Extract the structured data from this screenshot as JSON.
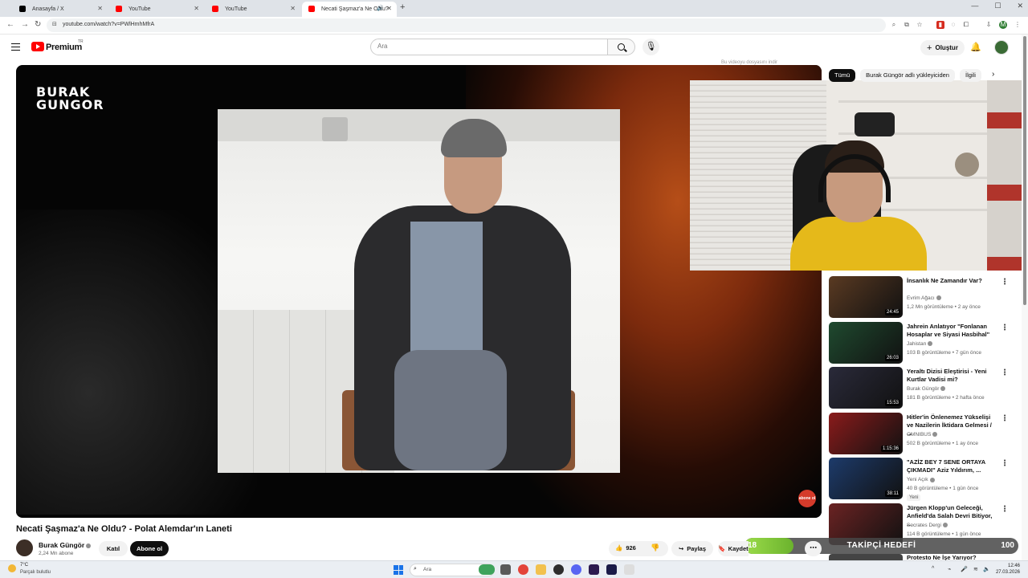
{
  "browser": {
    "tabs": [
      {
        "title": "Anasayfa / X",
        "favicon_color": "#000000"
      },
      {
        "title": "YouTube",
        "favicon_color": "#ff0000"
      },
      {
        "title": "YouTube",
        "favicon_color": "#ff0000"
      },
      {
        "title": "Necati Şaşmaz'a Ne Oldu?",
        "favicon_color": "#ff0000",
        "active": true
      }
    ],
    "url": "youtube.com/watch?v=PWlHmhMfrA"
  },
  "header": {
    "brand": "Premium",
    "region": "TR",
    "search_placeholder": "Ara",
    "create_label": "Oluştur"
  },
  "player": {
    "watermark_line1": "BURAK",
    "watermark_line2": "GUNGOR",
    "corner_badge": "abone ol",
    "overlay_tag": "Bu videoyu dosyasını indir"
  },
  "chips": [
    "Tümü",
    "Burak Güngör adlı yükleyiciden",
    "İlgili"
  ],
  "recommendations": [
    {
      "title": "İnsanlık Ne Zamandır Var?",
      "channel": "Evrim Ağacı",
      "meta": "1,2 Mn görüntüleme • 2 ay önce",
      "duration": "24:45",
      "thumb": "#5a3a22"
    },
    {
      "title": "Jahrein Anlatıyor \"Fonlanan Hosaplar ve Siyasi Hasbihal\"",
      "channel": "Jahistan",
      "meta": "103 B görüntüleme • 7 gün önce",
      "duration": "26:03",
      "thumb": "#1f4a2f"
    },
    {
      "title": "Yeraltı Dizisi Eleştirisi - Yeni Kurtlar Vadisi mi?",
      "channel": "Burak Güngör",
      "meta": "181 B görüntüleme • 2 hafta önce",
      "duration": "15:53",
      "thumb": "#2a2a3a"
    },
    {
      "title": "Hitler'in Önlenemez Yükselişi ve Nazilerin İktidara Gelmesi / ...",
      "channel": "OMNIBUS",
      "meta": "502 B görüntüleme • 1 ay önce",
      "duration": "1:15:36",
      "thumb": "#8a1b1b"
    },
    {
      "title": "\"AZİZ BEY 7 SENE ORTAYA ÇIKMADI\" Aziz Yıldırım, ...",
      "channel": "Yeni Açık",
      "meta": "40 B görüntüleme • 1 gün önce",
      "duration": "38:11",
      "thumb": "#1d3b6b",
      "badge": "Yeni"
    },
    {
      "title": "Jürgen Klopp'un Geleceği, Anfield'da Salah Devri Bitiyor, ...",
      "channel": "Socrates Dergi",
      "meta": "114 B görüntüleme • 1 gün önce",
      "duration": "",
      "thumb": "#6b2323"
    }
  ],
  "cut_rec_title": "Protesto Ne İşe Yarıyor?",
  "video": {
    "title": "Necati Şaşmaz'a Ne Oldu? - Polat Alemdar'ın Laneti",
    "channel": "Burak Güngör",
    "subscribers": "2,24 Mn abone",
    "join_label": "Katıl",
    "subscribe_label": "Abone ol",
    "likes": "926",
    "share_label": "Paylaş",
    "save_label": "Kaydet"
  },
  "goal": {
    "label": "TAKİPÇİ HEDEFİ",
    "current": "18",
    "target": "100",
    "progress": 0.18
  },
  "taskbar": {
    "weather_temp": "7°C",
    "weather_desc": "Parçalı bulutlu",
    "search_placeholder": "Ara",
    "time": "12:46",
    "date": "27.03.2026"
  }
}
